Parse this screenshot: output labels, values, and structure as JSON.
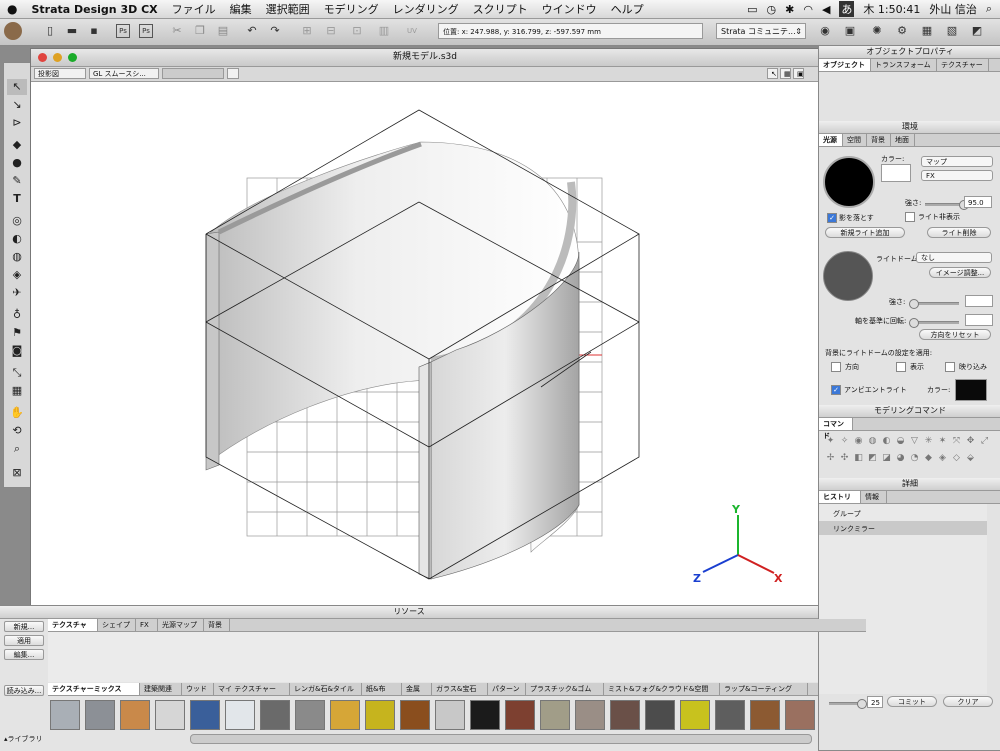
{
  "menubar": {
    "app": "Strata Design 3D CX",
    "items": [
      "ファイル",
      "編集",
      "選択範囲",
      "モデリング",
      "レンダリング",
      "スクリプト",
      "ウインドウ",
      "ヘルプ"
    ],
    "clock": "木 1:50:41",
    "user": "外山 信治",
    "input_mode": "あ"
  },
  "toolbar": {
    "coords": "位置:  x: 247.988, y: 316.799, z: -597.597 mm",
    "community": "Strata コミュニテ..."
  },
  "window": {
    "title": "新規モデル.s3d",
    "view_mode": "投影図",
    "render_mode": "GL スムースシ..."
  },
  "axes": {
    "y": "Y",
    "z": "Z",
    "x": "X"
  },
  "object_props": {
    "title": "オブジェクトプロパティ",
    "tabs": [
      "オブジェクト",
      "トランスフォーム",
      "テクスチャー"
    ]
  },
  "environment": {
    "title": "環境",
    "tabs": [
      "光源",
      "空間",
      "背景",
      "地面"
    ],
    "color_label": "カラー:",
    "map_select": "マップ",
    "fx_select": "FX",
    "strength_label": "強さ:",
    "strength_value": "95.0",
    "cast_shadow_label": "影を落とす",
    "cast_shadow_checked": true,
    "hide_light_label": "ライト非表示",
    "add_light_button": "新規ライト追加",
    "delete_light_button": "ライト削除",
    "light_dome_label": "ライトドーム:",
    "light_dome_value": "なし",
    "image_adjust_button": "イメージ調整...",
    "dome_strength_label": "強さ:",
    "rotate_axis_label": "軸を基準に回転:",
    "reset_direction_button": "方向をリセット",
    "apply_dome_label": "背景にライトドームの設定を適用:",
    "opt_direction": "方向",
    "opt_display": "表示",
    "opt_reflection": "映り込み",
    "ambient_label": "アンビエントライト",
    "ambient_checked": true,
    "ambient_color_label": "カラー:",
    "ambient_color": "#0a0a0a"
  },
  "modeling_commands": {
    "title": "モデリングコマンド",
    "tab": "コマンド"
  },
  "details": {
    "title": "詳細",
    "tabs": [
      "ヒストリー",
      "情報"
    ],
    "history": [
      "グループ",
      "リンクミラー"
    ],
    "undo_count": "25",
    "commit_button": "コミット",
    "clear_button": "クリア"
  },
  "resources": {
    "title": "リソース",
    "side_buttons": [
      "新規...",
      "適用",
      "編集..."
    ],
    "load_button": "読み込み...",
    "library_label": "▴ライブラリ",
    "tabs": [
      "テクスチャー",
      "シェイプ",
      "FX",
      "光源マップ",
      "背景"
    ],
    "categories": [
      "テクスチャーミックス",
      "建築関連",
      "ウッド",
      "マイ テクスチャー",
      "レンガ&石&タイル",
      "紙&布",
      "金属",
      "ガラス&宝石",
      "パターン",
      "プラスチック&ゴム",
      "ミスト&フォグ&クラウド&空間",
      "ラップ&コーティング"
    ],
    "swatch_colors": [
      "#a9afb6",
      "#8c9096",
      "#c9894a",
      "#d6d6d6",
      "#3a5f9a",
      "#e2e6ea",
      "#6a6a6a",
      "#8a8a8a",
      "#d6a637",
      "#c6b41e",
      "#8a4e1e",
      "#c8c8c8",
      "#1b1b1b",
      "#7d4030",
      "#a19d88",
      "#9a8e86",
      "#6a5048",
      "#4c4c4c",
      "#c8c21e",
      "#5e5e5e",
      "#8c5a32",
      "#9a7060"
    ]
  }
}
